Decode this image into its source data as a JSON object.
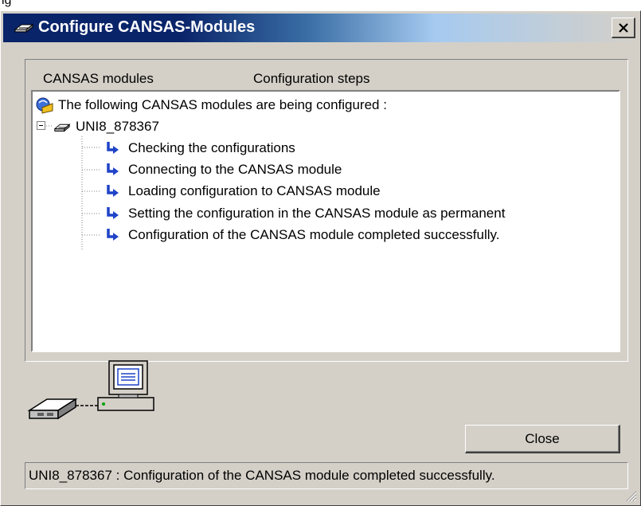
{
  "window": {
    "title": "Configure CANSAS-Modules",
    "close_glyph": "✕",
    "colors": {
      "titlebar_start": "#0a246a",
      "titlebar_end": "#d4d0c8",
      "face": "#d4d0c8"
    }
  },
  "tabs": [
    {
      "label": "CANSAS modules"
    },
    {
      "label": "Configuration steps"
    }
  ],
  "tree": {
    "header": {
      "label": "The following CANSAS modules are being configured :",
      "icon": "cansas-modules-icon"
    },
    "module": {
      "label": "UNI8_878367",
      "icon": "module-icon",
      "expanded": true
    },
    "steps": [
      {
        "label": "Checking the configurations",
        "icon": "step-arrow-icon"
      },
      {
        "label": "Connecting to the CANSAS module",
        "icon": "step-arrow-icon"
      },
      {
        "label": "Loading configuration to CANSAS module",
        "icon": "step-arrow-icon"
      },
      {
        "label": "Setting the configuration in the CANSAS module as permanent",
        "icon": "step-arrow-icon"
      },
      {
        "label": "Configuration of the CANSAS module completed successfully.",
        "icon": "step-arrow-icon"
      }
    ]
  },
  "buttons": {
    "close_label": "Close"
  },
  "status": {
    "text": "UNI8_878367 : Configuration of the CANSAS module completed successfully."
  }
}
